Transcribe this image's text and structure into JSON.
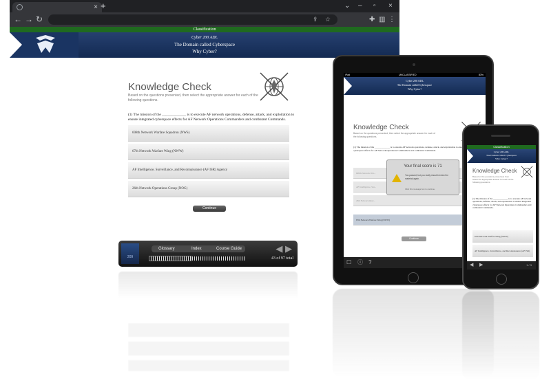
{
  "browser": {
    "tab_close": "×",
    "new_tab": "+",
    "window_controls": [
      "⌄",
      "–",
      "▫",
      "×"
    ],
    "nav": {
      "back": "←",
      "forward": "→",
      "reload": "↻"
    }
  },
  "header": {
    "classification": "Classification",
    "course": "Cyber 200 ADL",
    "title": "The Domain called Cyberspace",
    "subtitle": "Why Cyber?"
  },
  "content": {
    "title": "Knowledge Check",
    "instructions": "Based on the questions presented, then select the appropriate answer for each of the following questions.",
    "question": "(1) The mission of the _____________ is to execute AF network operations, defense, attack, and exploitation to ensure integrated cyberspace effects for AF Network Operations Commanders and combatant Commands.",
    "options": [
      "608th Network Warfare Squadron (NWS)",
      "67th Network Warfare Wing (NWW)",
      "AF Intelligence, Surveillance, and Reconnaissance (AF ISR) Agency",
      "26th Network Operations Group (NOG)"
    ],
    "continue_label": "Continue"
  },
  "console": {
    "logo_text": "209",
    "tabs": [
      "Glossary",
      "Index",
      "Course Guide"
    ],
    "prev": "◀",
    "next": "▶",
    "page_count": "43 of 97 total",
    "progress": 0.44
  },
  "tablet": {
    "status_left": "iPad",
    "status_center": "UNCLASSIFIED",
    "status_right": "83%",
    "course": "Cyber 200 ADL",
    "title": "The Domain called Cyberspace",
    "subtitle": "Why Cyber?",
    "kc_title": "Knowledge Check",
    "instructions": "Based on the questions presented, then select the appropriate answer for each of the following questions.",
    "question": "(1) The mission of the _____________ is to execute AF network operations, defense, attack, and exploitation to ensure integrated cyberspace effects for AF Network Operations Commanders and combatant Commands.",
    "options": [
      "608th Network War...",
      "AF Intelligence, Sur...",
      "26th Network Oper...",
      "67th Network Warfare Wing (NWW)"
    ],
    "continue_label": "Continue",
    "modal": {
      "title": "Your final score is 71",
      "text": "You passed, but you really should review the material again.",
      "footer": "Click this message box to continue."
    },
    "bottom_icons": [
      "☐",
      "ⓘ",
      "?"
    ],
    "page_info": "43 of 97"
  },
  "phone": {
    "classification": "Classification",
    "course": "Cyber 200 ADL",
    "title": "The Domain called Cyberspace",
    "subtitle": "Why Cyber?",
    "kc_title": "Knowledge Check",
    "instructions": "Based on the questions presented, then select the appropriate answer for each of the following questions.",
    "question": "(1) The mission of the _____________ is to execute AF network operations, defense, attack, and exploitation to ensure integrated cyberspace effects for AF Network Operations Commanders and combatant Commands.",
    "options": [
      "67th Network Warfare Wing (NWW)",
      "AF Intelligence, Surveillance, and Reconnaissance (AF ISR) Agency"
    ],
    "prev": "◀",
    "next": "▶",
    "page_info": "1 / 3"
  },
  "colors": {
    "af_blue": "#1a3462",
    "classification_green": "#1f6a1f",
    "console_dark": "#111111"
  }
}
